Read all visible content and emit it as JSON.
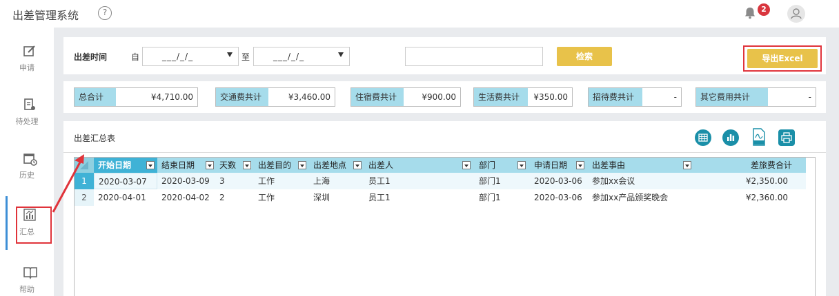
{
  "app": {
    "title": "出差管理系统",
    "help_symbol": "?"
  },
  "header": {
    "notification_count": "2"
  },
  "sidebar": {
    "items": [
      {
        "label": "申请",
        "icon": "edit-icon"
      },
      {
        "label": "待处理",
        "icon": "pending-doc-icon"
      },
      {
        "label": "历史",
        "icon": "calendar-clock-icon"
      },
      {
        "label": "汇总",
        "icon": "bar-chart-icon",
        "active": true
      },
      {
        "label": "帮助",
        "icon": "book-icon"
      }
    ]
  },
  "filter": {
    "label": "出差时间",
    "from_label": "自",
    "to_label": "至",
    "from_value": "___/_/_",
    "to_value": "___/_/_",
    "search_value": "",
    "search_button": "检索",
    "export_button": "导出Excel"
  },
  "summary": [
    {
      "label": "总合计",
      "value": "¥4,710.00"
    },
    {
      "label": "交通费共计",
      "value": "¥3,460.00"
    },
    {
      "label": "住宿费共计",
      "value": "¥900.00"
    },
    {
      "label": "生活费共计",
      "value": "¥350.00"
    },
    {
      "label": "招待费共计",
      "value": "-"
    },
    {
      "label": "其它费用共计",
      "value": "-"
    }
  ],
  "table": {
    "title": "出差汇总表",
    "columns": [
      "开始日期",
      "结束日期",
      "天数",
      "出差目的",
      "出差地点",
      "出差人",
      "部门",
      "申请日期",
      "出差事由",
      "差旅费合计"
    ],
    "rows": [
      {
        "num": "1",
        "cells": [
          "2020-03-07",
          "2020-03-09",
          "3",
          "工作",
          "上海",
          "员工1",
          "部门1",
          "2020-03-06",
          "参加xx会议",
          "¥2,350.00"
        ]
      },
      {
        "num": "2",
        "cells": [
          "2020-04-01",
          "2020-04-02",
          "2",
          "工作",
          "深圳",
          "员工1",
          "部门1",
          "2020-03-06",
          "参加xx产品颁奖晚会",
          "¥2,360.00"
        ]
      }
    ]
  },
  "colors": {
    "accent_yellow": "#e8c24a",
    "header_cyan": "#a6dceb",
    "highlight_red": "#e0333a",
    "icon_teal": "#1a8fa8"
  }
}
